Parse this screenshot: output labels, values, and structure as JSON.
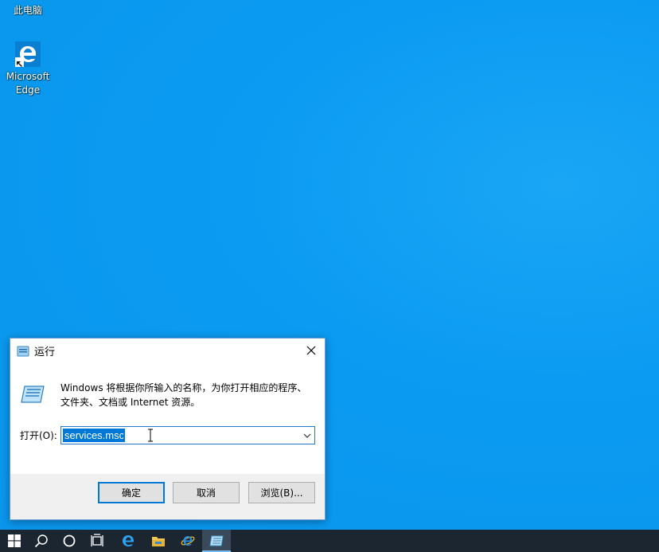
{
  "desktop": {
    "this_pc_label": "此电脑",
    "edge_label_line1": "Microsoft",
    "edge_label_line2": "Edge"
  },
  "run_dialog": {
    "title": "运行",
    "description_line1": "Windows 将根据你所输入的名称，为你打开相应的程序、",
    "description_line2": "文件夹、文档或 Internet 资源。",
    "open_label": "打开(O):",
    "open_value": "services.msc",
    "buttons": {
      "ok": "确定",
      "cancel": "取消",
      "browse": "浏览(B)..."
    }
  },
  "taskbar": {
    "items": [
      "start-icon",
      "search-icon",
      "cortana-icon",
      "task-view-icon",
      "edge-icon",
      "file-explorer-icon",
      "ie-icon",
      "run-icon"
    ],
    "active_item": "run-icon"
  },
  "colors": {
    "desktop": "#0a96ec",
    "taskbar": "#1b2631",
    "accent": "#0078d7"
  }
}
